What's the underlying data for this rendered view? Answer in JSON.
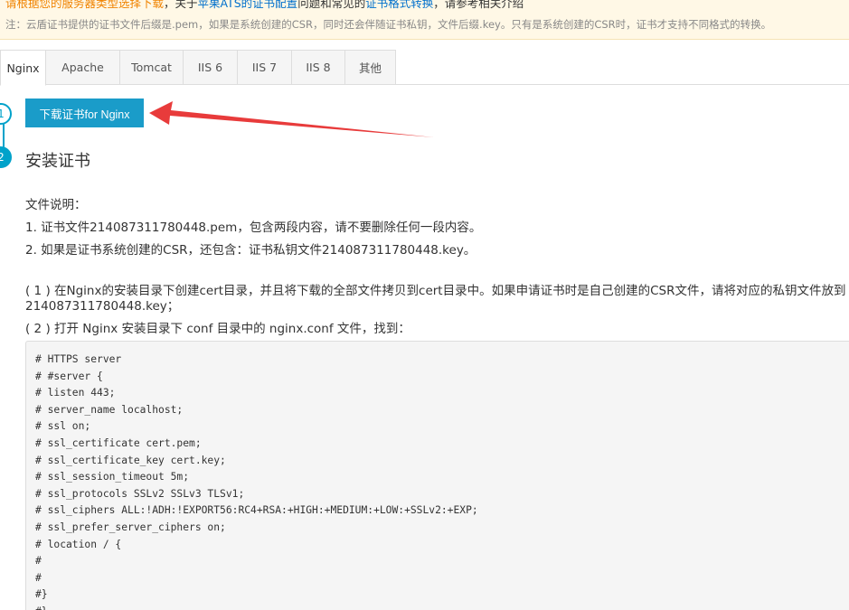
{
  "notice": {
    "line1_part1": "请根据您的服务器类型选择下载",
    "line1_part2": "，关于",
    "line1_link1": "苹果ATS的证书配置",
    "line1_part3": "问题和常见的",
    "line1_link2": "证书格式转换",
    "line1_part4": "，请参考相关介绍",
    "line2": "注：云盾证书提供的证书文件后缀是.pem，如果是系统创建的CSR，同时还会伴随证书私钥，文件后缀.key。只有是系统创建的CSR时，证书才支持不同格式的转换。"
  },
  "tabs": [
    {
      "label": "Nginx",
      "active": true
    },
    {
      "label": "Apache",
      "active": false
    },
    {
      "label": "Tomcat",
      "active": false
    },
    {
      "label": "IIS 6",
      "active": false
    },
    {
      "label": "IIS 7",
      "active": false
    },
    {
      "label": "IIS 8",
      "active": false
    },
    {
      "label": "其他",
      "active": false
    }
  ],
  "steps": {
    "step1_number": "1",
    "step2_number": "2",
    "download_button": "下载证书for Nginx",
    "install_title": "安装证书"
  },
  "content": {
    "files_heading": "文件说明：",
    "file_item_1": "1. 证书文件214087311780448.pem，包含两段内容，请不要删除任何一段内容。",
    "file_item_2": "2. 如果是证书系统创建的CSR，还包含：证书私钥文件214087311780448.key。",
    "step_1_text": "( 1 ) 在Nginx的安装目录下创建cert目录，并且将下载的全部文件拷贝到cert目录中。如果申请证书时是自己创建的CSR文件，请将对应的私钥文件放到",
    "step_1_text_cont": "214087311780448.key；",
    "step_2_text": "( 2 ) 打开 Nginx 安装目录下 conf 目录中的 nginx.conf 文件，找到："
  },
  "code_lines": [
    "# HTTPS server",
    "# #server {",
    "# listen 443;",
    "# server_name localhost;",
    "# ssl on;",
    "# ssl_certificate cert.pem;",
    "# ssl_certificate_key cert.key;",
    "# ssl_session_timeout 5m;",
    "# ssl_protocols SSLv2 SSLv3 TLSv1;",
    "# ssl_ciphers ALL:!ADH:!EXPORT56:RC4+RSA:+HIGH:+MEDIUM:+LOW:+SSLv2:+EXP;",
    "# ssl_prefer_server_ciphers on;",
    "# location / {",
    "#",
    "#",
    "#}",
    "#}"
  ],
  "colors": {
    "accent": "#1a9cc9",
    "arrow": "#e83b3b",
    "notice_bg": "#fff8e6"
  }
}
